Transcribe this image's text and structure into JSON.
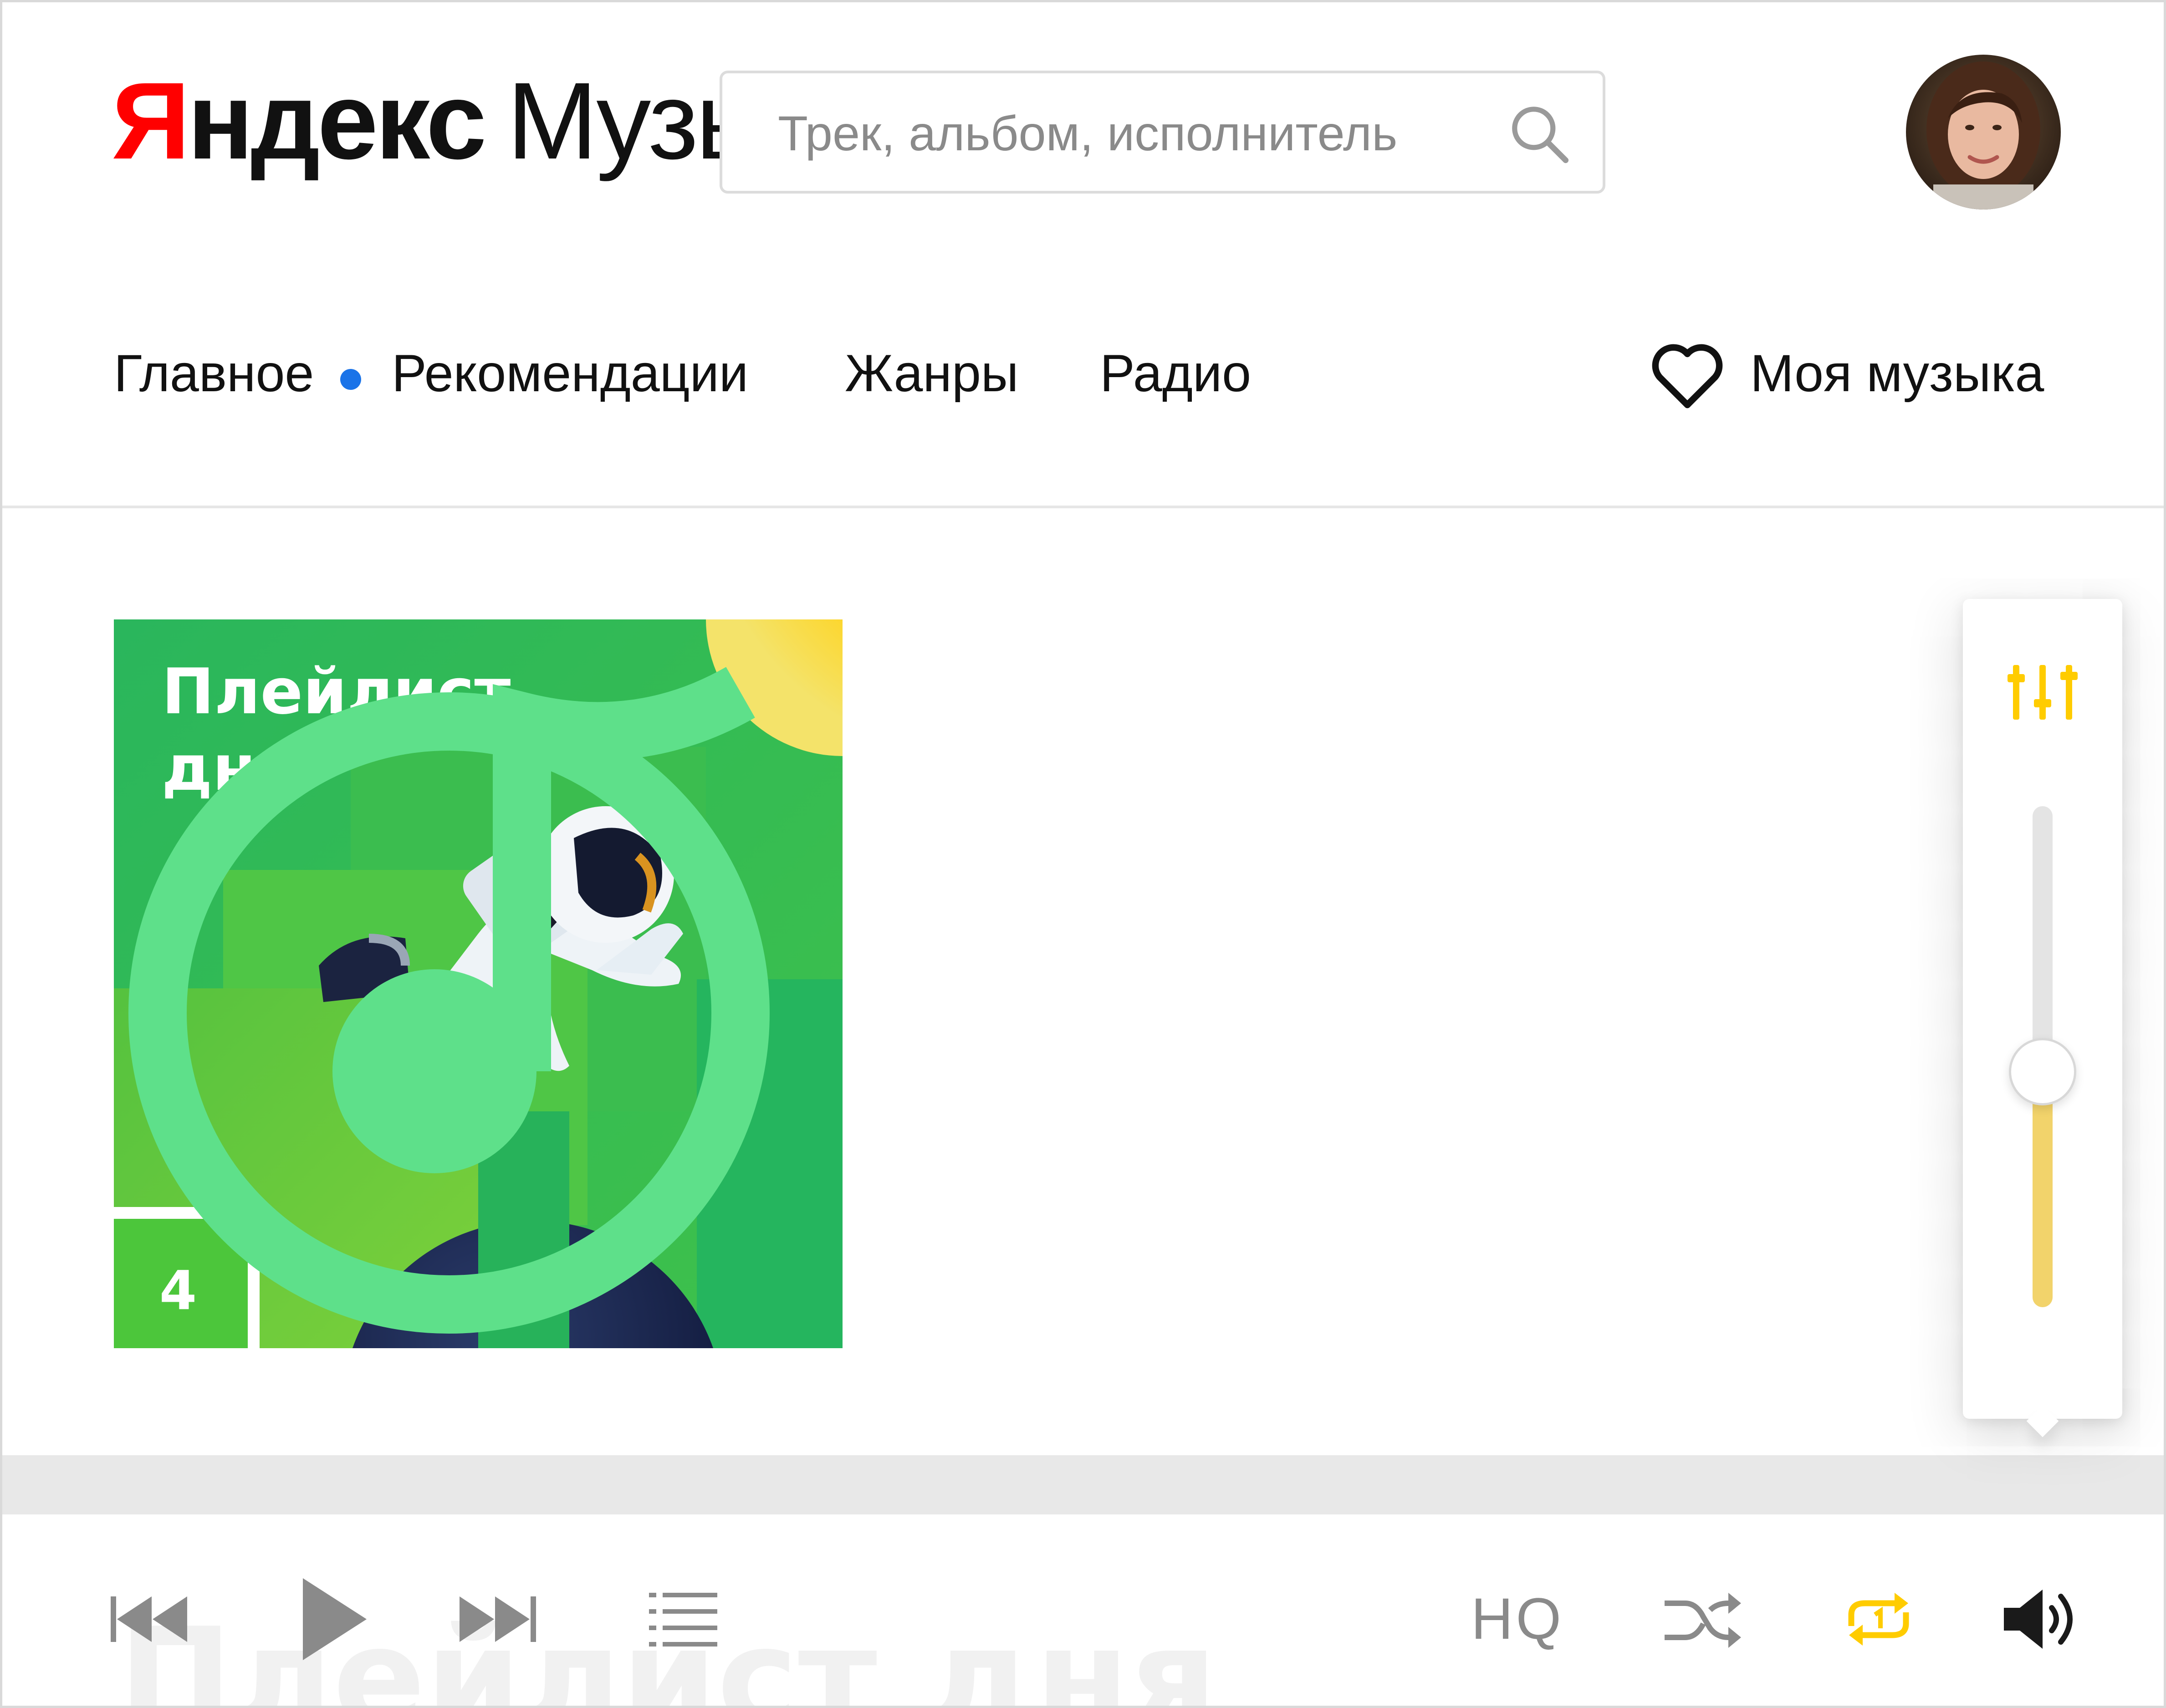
{
  "header": {
    "logo": {
      "first_letter": "Я",
      "rest": "ндекс",
      "product": "Музыка"
    },
    "search": {
      "placeholder": "Трек, альбом, исполнитель",
      "value": ""
    },
    "avatar_icon": "user-avatar-photo"
  },
  "nav": {
    "items": [
      {
        "label": "Главное"
      },
      {
        "label": "Рекомендации",
        "has_new_dot": true
      },
      {
        "label": "Жанры"
      },
      {
        "label": "Радио"
      }
    ],
    "dot_color": "#1a73e8",
    "my_music": {
      "label": "Моя музыка",
      "icon": "heart-icon"
    }
  },
  "cover": {
    "title_line1": "Плейлист",
    "title_line2": "дня",
    "badge_number": "4",
    "colors": {
      "green": "#2bb55a",
      "light_green": "#6cc93a",
      "sun": "#ffd21a",
      "planet": "#1d2a4e"
    },
    "brand_icon": "music-note-logo-icon"
  },
  "ghost_title": "Плейлист дня",
  "player": {
    "controls": [
      "prev-track-icon",
      "play-icon",
      "next-track-icon",
      "queue-list-icon"
    ],
    "quality_label": "HQ",
    "shuffle_icon": "shuffle-icon",
    "repeat_icon": "repeat-one-icon",
    "repeat_active_color": "#ffcc00",
    "volume_icon": "speaker-volume-icon",
    "inactive_color": "#8a8a8a"
  },
  "volume_popup": {
    "eq_icon": "equalizer-icon",
    "eq_color": "#ffcc00",
    "volume_level": 0.47,
    "fill_color": "#f2d36b"
  }
}
